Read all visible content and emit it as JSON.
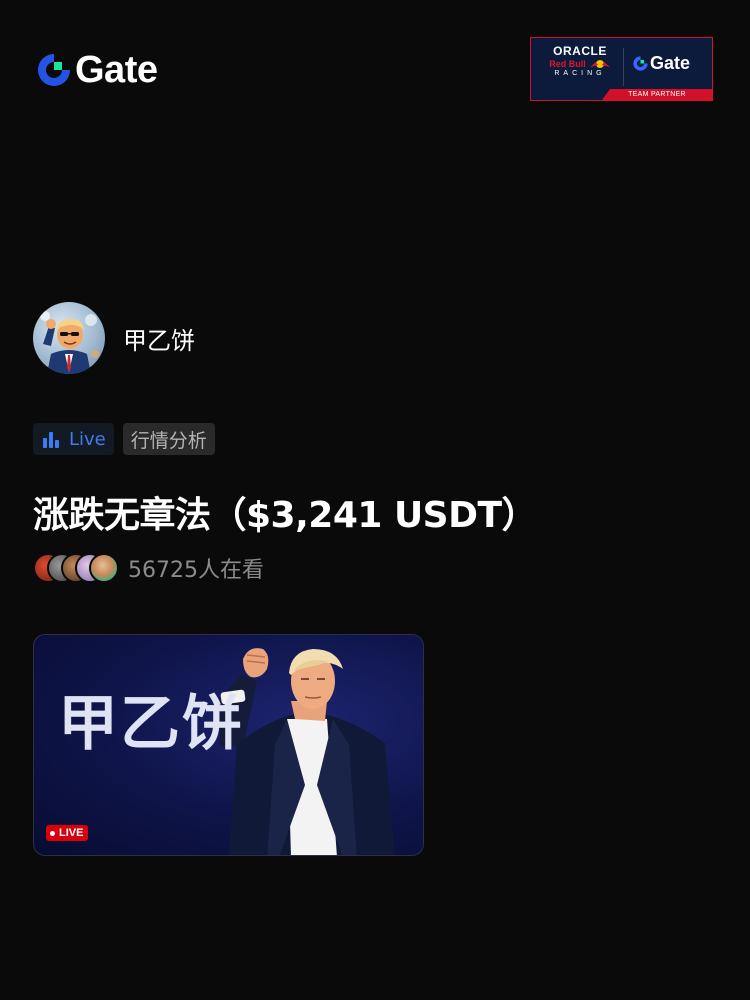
{
  "header": {
    "brand": "Gate",
    "partner": {
      "line1": "ORACLE",
      "line2": "Red Bull",
      "line3": "RACING",
      "brand": "Gate",
      "band": "TEAM PARTNER"
    }
  },
  "host": {
    "name": "甲乙饼"
  },
  "tags": {
    "live": "Live",
    "category": "行情分析"
  },
  "title": "涨跌无章法（$3,241 USDT）",
  "viewers": {
    "count_text": "56725人在看"
  },
  "thumbnail": {
    "overlay_text": "甲乙饼",
    "badge": "LIVE"
  },
  "colors": {
    "background": "#0a0a0a",
    "accent_blue": "#3d7bf2",
    "gate_green": "#17e6a1",
    "live_red": "#d9000d"
  }
}
